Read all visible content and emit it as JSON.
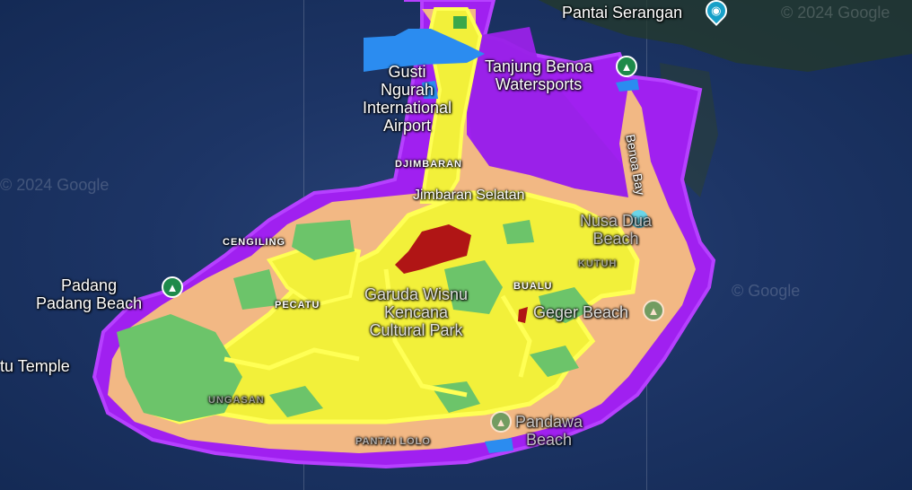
{
  "map": {
    "labels": {
      "pantai_serangan": "Pantai Serangan",
      "tanjung_benoa_1": "Tanjung Benoa",
      "tanjung_benoa_2": "Watersports",
      "gusti_1": "Gusti",
      "gusti_2": "Ngurah",
      "gusti_3": "International",
      "gusti_4": "Airport",
      "djimbaran": "DJIMBARAN",
      "jimbaran_selatan": "Jimbaran Selatan",
      "ungasan_area": "UNGASAN",
      "padang_1": "Padang",
      "padang_2": "Padang Beach",
      "temple": "tu Temple",
      "pecatu": "PECATU",
      "cengiling": "CENGILING",
      "garuda_1": "Garuda Wisnu",
      "garuda_2": "Kencana",
      "garuda_3": "Cultural Park",
      "bualu": "BUALU",
      "geger": "Geger Beach",
      "nusa_dua_1": "Nusa Dua",
      "nusa_dua_2": "Beach",
      "benoa_bay": "Benoa Bay",
      "pandawa_1": "Pandawa",
      "pandawa_2": "Beach",
      "kutuh": "KUTUH",
      "pantai_melasti": "PANTAI LOLO"
    },
    "watermarks": {
      "top_right": "© 2024 Google",
      "left": "© 2024 Google",
      "right": "© Google"
    },
    "icons": {
      "camera": "camera-icon",
      "beach": "beach-icon",
      "tree": "tree-icon"
    },
    "colors": {
      "sea": "#1d3566",
      "purple_zone": "#a020f0",
      "yellow_zone": "#f2f03a",
      "peach_zone": "#f2b884",
      "green_zone": "#6cc46a",
      "red_zone": "#b01515",
      "blue_zone": "#2b8cf0"
    }
  }
}
